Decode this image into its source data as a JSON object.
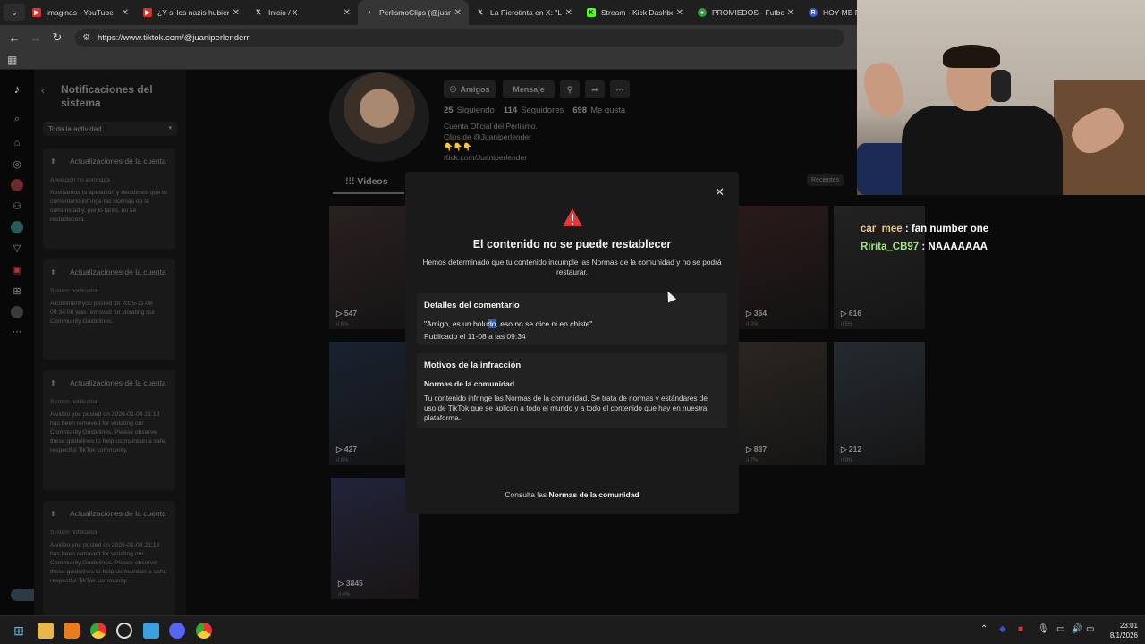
{
  "browser": {
    "tabs": [
      {
        "title": "imaginas - YouTube",
        "icon": "youtube-icon",
        "color": "#e52d27"
      },
      {
        "title": "¿Y si los nazis hubieran",
        "icon": "youtube-icon",
        "color": "#e52d27"
      },
      {
        "title": "Inicio / X",
        "icon": "x-icon",
        "color": "#000000"
      },
      {
        "title": "PerlismoClips (@juan",
        "icon": "tiktok-icon",
        "color": "#111111"
      },
      {
        "title": "La Pierotinta en X: \"L",
        "icon": "x-icon",
        "color": "#000000"
      },
      {
        "title": "Stream - Kick Dashbo",
        "icon": "kick-icon",
        "color": "#53fc18"
      },
      {
        "title": "PROMIEDOS - Futbol",
        "icon": "promiedos-icon",
        "color": "#2e9e3c"
      },
      {
        "title": "HOY ME PASO",
        "icon": "reddit-icon",
        "color": "#3b5bdb"
      }
    ],
    "active_tab_index": 3,
    "url": "https://www.tiktok.com/@juaniperlenderr"
  },
  "sidebar": {
    "title": "Notificaciones del sistema",
    "filter": "Toda la actividad",
    "cards": [
      {
        "title": "Actualizaciones de la cuenta",
        "sub": "Apelación no aprobada",
        "body": "Revisamos tu apelación y decidimos que tu comentario infringe las Normas de la comunidad y, por lo tanto, no se restablecerá."
      },
      {
        "title": "Actualizaciones de la cuenta",
        "sub": "System notification",
        "body": "A comment you posted on 2025-11-08 09:34:06 was removed for violating our Community Guidelines."
      },
      {
        "title": "Actualizaciones de la cuenta",
        "sub": "System notification",
        "body": "A video you posted on 2026-01-04 21:13 has been removed for violating our Community Guidelines. Please observe these guidelines to help us maintain a safe, respectful TikTok community."
      },
      {
        "title": "Actualizaciones de la cuenta",
        "sub": "System notification",
        "body": "A video you posted on 2026-01-04 21:13 has been removed for violating our Community Guidelines. Please observe these guidelines to help us maintain a safe, respectful TikTok community."
      }
    ]
  },
  "profile": {
    "buttons": {
      "friends": "Amigos",
      "message": "Mensaje"
    },
    "stats": [
      {
        "value": "25",
        "label": "Siguiendo"
      },
      {
        "value": "114",
        "label": "Seguidores"
      },
      {
        "value": "698",
        "label": "Me gusta"
      }
    ],
    "bio": [
      "Cuenta Oficial del Perlismo.",
      "Clips de @Juaniperlender",
      "👇👇👇",
      "Kick.com/Juaniperlender"
    ],
    "tab_videos": "Videos",
    "sort": "Recientes"
  },
  "videos": [
    {
      "views": "547",
      "pct": "6%"
    },
    {
      "views": "364",
      "pct": "5%"
    },
    {
      "views": "616",
      "pct": "5%"
    },
    {
      "views": "427",
      "pct": "8%"
    },
    {
      "views": "837",
      "pct": "7%"
    },
    {
      "views": "212",
      "pct": "9%"
    },
    {
      "views": "3845",
      "pct": "4%"
    }
  ],
  "modal": {
    "title": "El contenido no se puede restablecer",
    "description": "Hemos determinado que tu contenido incumple las Normas de la comunidad y no se podrá restaurar.",
    "details_title": "Detalles del comentario",
    "quote_before": "\"Amigo, es un bolu",
    "quote_highlight": "do",
    "quote_after": ", eso no se dice ni en chiste\"",
    "published": "Publicado el 11-08 a las 09:34",
    "reasons_title": "Motivos de la infracción",
    "norm_title": "Normas de la comunidad",
    "norm_body": "Tu contenido infringe las Normas de la comunidad. Se trata de normas y estándares de uso de TikTok que se aplican a todo el mundo y a todo el contenido que hay en nuestra plataforma.",
    "footer_prefix": "Consulta las",
    "footer_link": "Normas de la comunidad"
  },
  "chat": [
    {
      "user": "car_mee",
      "message": ": fan number one"
    },
    {
      "user": "Ririta_CB97",
      "message": ": NAAAAAAA"
    }
  ],
  "taskbar": {
    "time": "23:01",
    "date": "8/1/2026"
  }
}
